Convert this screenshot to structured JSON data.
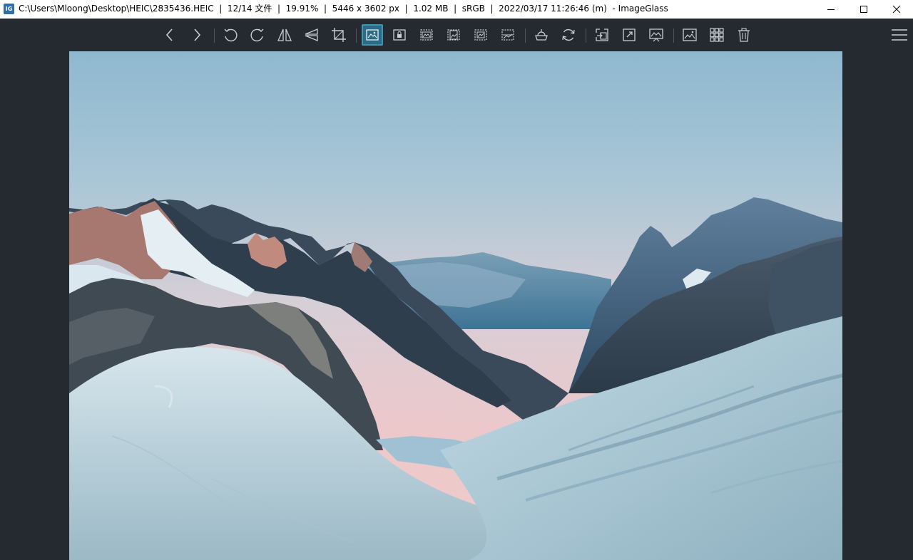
{
  "window": {
    "title": "C:\\Users\\Mloong\\Desktop\\HEIC\\2835436.HEIC  |  12/14 文件  |  19.91%  |  5446 x 3602 px  |  1.02 MB  |  sRGB  |  2022/03/17 11:26:46 (m)  - ImageGlass",
    "app_icon_text": "IG",
    "controls": [
      "minimize-icon",
      "maximize-icon",
      "close-icon"
    ]
  },
  "toolbar": {
    "buttons": [
      {
        "icon": "chevron-left-icon",
        "action": "Previous image"
      },
      {
        "icon": "chevron-right-icon",
        "action": "Next image"
      },
      {
        "icon": "rotate-left-icon",
        "action": "Rotate left"
      },
      {
        "icon": "rotate-right-icon",
        "action": "Rotate right"
      },
      {
        "icon": "flip-horizontal-icon",
        "action": "Flip horizontal"
      },
      {
        "icon": "flip-vertical-icon",
        "action": "Flip vertical"
      },
      {
        "icon": "crop-icon",
        "action": "Crop"
      },
      {
        "icon": "auto-zoom-icon",
        "action": "Auto zoom",
        "active": true
      },
      {
        "icon": "lock-zoom-icon",
        "action": "Lock zoom"
      },
      {
        "icon": "scale-to-width-icon",
        "action": "Scale to width"
      },
      {
        "icon": "scale-to-height-icon",
        "action": "Scale to height"
      },
      {
        "icon": "scale-to-fit-icon",
        "action": "Scale to fit"
      },
      {
        "icon": "scale-to-fill-icon",
        "action": "Scale to fill"
      },
      {
        "icon": "open-with-icon",
        "action": "Open with"
      },
      {
        "icon": "refresh-icon",
        "action": "Refresh"
      },
      {
        "icon": "goto-icon",
        "action": "Go to image"
      },
      {
        "icon": "fullscreen-icon",
        "action": "Full screen"
      },
      {
        "icon": "slideshow-icon",
        "action": "Slideshow"
      },
      {
        "icon": "thumbnail-bar-icon",
        "action": "Thumbnail bar"
      },
      {
        "icon": "checkerboard-icon",
        "action": "Checkerboard"
      },
      {
        "icon": "delete-icon",
        "action": "Delete"
      },
      {
        "icon": "menu-icon",
        "action": "Main menu"
      }
    ],
    "accent_color": "#3c97b7"
  },
  "viewer": {
    "background": "#252a31",
    "image_subject": "snow-mountain-landscape"
  }
}
